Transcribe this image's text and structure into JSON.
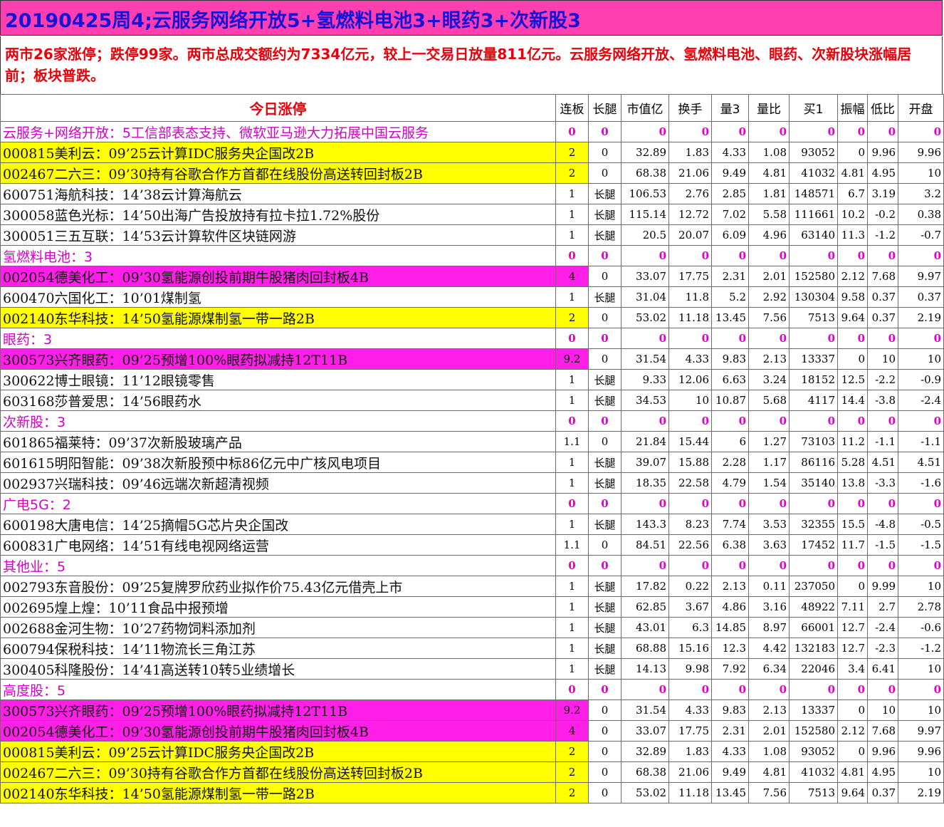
{
  "title": "20190425周4;云服务网络开放5+氢燃料电池3+眼药3+次新股3",
  "summary": "两市26家涨停；跌停99家。两市总成交额约为7334亿元，较上一交易日放量811亿元。云服务网络开放、氢燃料电池、眼药、次新股块涨幅居前；板块普跌。",
  "headers": [
    "今日涨停",
    "连板",
    "长腿",
    "市值亿",
    "换手",
    "量3",
    "量比",
    "买1",
    "振幅",
    "低比",
    "开盘"
  ],
  "rows": [
    {
      "type": "cat",
      "name": "云服务+网络开放：5工信部表态支持、微软亚马逊大力拓展中国云服务",
      "vals": [
        "0",
        "0",
        "0",
        "0",
        "0",
        "0",
        "0",
        "0",
        "0",
        "0"
      ]
    },
    {
      "type": "stock",
      "hl": "yellow",
      "name": "000815美利云：09’25云计算IDC服务央企国改2B",
      "vals": [
        "2",
        "0",
        "32.89",
        "1.83",
        "4.33",
        "1.08",
        "93052",
        "0",
        "9.96",
        "9.96"
      ]
    },
    {
      "type": "stock",
      "hl": "yellow",
      "name": "002467二六三：09’30持有谷歌合作方首都在线股份高送转回封板2B",
      "vals": [
        "2",
        "0",
        "68.38",
        "21.06",
        "9.49",
        "4.81",
        "41032",
        "4.81",
        "4.95",
        "10"
      ]
    },
    {
      "type": "stock",
      "hl": "",
      "name": "600751海航科技：14’38云计算海航云",
      "vals": [
        "1",
        "长腿",
        "106.53",
        "2.76",
        "2.85",
        "1.81",
        "148571",
        "6.7",
        "3.19",
        "3.2"
      ]
    },
    {
      "type": "stock",
      "hl": "",
      "name": "300058蓝色光标：14’50出海广告投放持有拉卡拉1.72%股份",
      "vals": [
        "1",
        "长腿",
        "115.14",
        "12.72",
        "7.02",
        "5.58",
        "111661",
        "10.2",
        "-0.2",
        "0.38"
      ]
    },
    {
      "type": "stock",
      "hl": "",
      "name": "300051三五互联：14’53云计算软件区块链网游",
      "vals": [
        "1",
        "长腿",
        "20.5",
        "20.07",
        "6.09",
        "4.96",
        "63140",
        "11.3",
        "-1.2",
        "-0.7"
      ]
    },
    {
      "type": "cat",
      "name": "氢燃料电池：3",
      "vals": [
        "0",
        "0",
        "0",
        "0",
        "0",
        "0",
        "0",
        "0",
        "0",
        "0"
      ]
    },
    {
      "type": "stock",
      "hl": "magenta",
      "name": "002054德美化工：09’30氢能源创投前期牛股猪肉回封板4B",
      "vals": [
        "4",
        "0",
        "33.07",
        "17.75",
        "2.31",
        "2.01",
        "152580",
        "2.12",
        "7.68",
        "9.97"
      ]
    },
    {
      "type": "stock",
      "hl": "",
      "name": "600470六国化工：10’01煤制氢",
      "vals": [
        "1",
        "长腿",
        "31.04",
        "11.8",
        "5.2",
        "2.92",
        "130304",
        "9.58",
        "0.37",
        "0.37"
      ]
    },
    {
      "type": "stock",
      "hl": "yellow",
      "name": "002140东华科技：14’50氢能源煤制氢一带一路2B",
      "vals": [
        "2",
        "0",
        "53.02",
        "11.18",
        "13.45",
        "7.56",
        "7513",
        "9.64",
        "0.37",
        "2.19"
      ]
    },
    {
      "type": "cat",
      "name": "眼药：3",
      "vals": [
        "0",
        "0",
        "0",
        "0",
        "0",
        "0",
        "0",
        "0",
        "0",
        "0"
      ]
    },
    {
      "type": "stock",
      "hl": "magenta",
      "name": "300573兴齐眼药：09’25预增100%眼药拟减持12T11B",
      "vals": [
        "9.2",
        "0",
        "31.54",
        "4.33",
        "9.83",
        "2.13",
        "13337",
        "0",
        "10",
        "10"
      ]
    },
    {
      "type": "stock",
      "hl": "",
      "name": "300622博士眼镜：11’12眼镜零售",
      "vals": [
        "1",
        "长腿",
        "9.33",
        "12.06",
        "6.63",
        "3.24",
        "18152",
        "12.5",
        "-2.2",
        "-0.9"
      ]
    },
    {
      "type": "stock",
      "hl": "",
      "name": "603168莎普爱思：14’56眼药水",
      "vals": [
        "1",
        "长腿",
        "34.53",
        "10",
        "10.87",
        "5.68",
        "4117",
        "14.4",
        "-3.8",
        "-2.4"
      ]
    },
    {
      "type": "cat",
      "name": "次新股：3",
      "vals": [
        "0",
        "0",
        "0",
        "0",
        "0",
        "0",
        "0",
        "0",
        "0",
        "0"
      ]
    },
    {
      "type": "stock",
      "hl": "",
      "name": "601865福莱特：09’37次新股玻璃产品",
      "vals": [
        "1.1",
        "0",
        "21.84",
        "15.44",
        "6",
        "1.27",
        "73103",
        "11.2",
        "-1.1",
        "-1.1"
      ]
    },
    {
      "type": "stock",
      "hl": "",
      "name": "601615明阳智能：09’38次新股预中标86亿元中广核风电项目",
      "vals": [
        "1",
        "长腿",
        "39.07",
        "15.88",
        "2.28",
        "1.17",
        "86116",
        "5.28",
        "4.51",
        "4.51"
      ]
    },
    {
      "type": "stock",
      "hl": "",
      "name": "002937兴瑞科技：09’46远端次新超清视频",
      "vals": [
        "1",
        "长腿",
        "18.35",
        "22.58",
        "4.79",
        "1.54",
        "35140",
        "13.8",
        "-3.3",
        "-1.6"
      ]
    },
    {
      "type": "cat",
      "name": "广电5G：2",
      "vals": [
        "0",
        "0",
        "0",
        "0",
        "0",
        "0",
        "0",
        "0",
        "0",
        "0"
      ]
    },
    {
      "type": "stock",
      "hl": "",
      "name": "600198大唐电信：14’25摘帽5G芯片央企国改",
      "vals": [
        "1",
        "长腿",
        "143.3",
        "8.23",
        "7.74",
        "3.53",
        "32355",
        "15.5",
        "-4.8",
        "-0.5"
      ]
    },
    {
      "type": "stock",
      "hl": "",
      "name": "600831广电网络：14’51有线电视网络运营",
      "vals": [
        "1.1",
        "0",
        "84.51",
        "22.56",
        "6.38",
        "3.63",
        "17452",
        "11.7",
        "-1.5",
        "-1.5"
      ]
    },
    {
      "type": "cat",
      "name": "其他业：5",
      "vals": [
        "0",
        "0",
        "0",
        "0",
        "0",
        "0",
        "0",
        "0",
        "0",
        "0"
      ]
    },
    {
      "type": "stock",
      "hl": "",
      "name": "002793东音股份：09’25复牌罗欣药业拟作价75.43亿元借壳上市",
      "vals": [
        "1",
        "长腿",
        "17.82",
        "0.22",
        "2.13",
        "0.11",
        "237050",
        "0",
        "9.99",
        "10"
      ]
    },
    {
      "type": "stock",
      "hl": "",
      "name": "002695煌上煌：10’11食品中报预增",
      "vals": [
        "1",
        "长腿",
        "62.85",
        "3.67",
        "4.86",
        "3.16",
        "48922",
        "7.11",
        "2.7",
        "2.78"
      ]
    },
    {
      "type": "stock",
      "hl": "",
      "name": "002688金河生物：10’27药物饲料添加剂",
      "vals": [
        "1",
        "长腿",
        "43.01",
        "6.3",
        "14.85",
        "8.97",
        "66001",
        "12.7",
        "-2.4",
        "-0.6"
      ]
    },
    {
      "type": "stock",
      "hl": "",
      "name": "600794保税科技：14’11物流长三角江苏",
      "vals": [
        "1",
        "长腿",
        "68.88",
        "15.16",
        "12.3",
        "4.42",
        "132183",
        "12.7",
        "-2.3",
        "-1.2"
      ]
    },
    {
      "type": "stock",
      "hl": "",
      "name": "300405科隆股份：14’41高送转10转5业绩增长",
      "vals": [
        "1",
        "长腿",
        "14.13",
        "9.98",
        "7.92",
        "6.34",
        "22046",
        "3.4",
        "6.41",
        "10"
      ]
    },
    {
      "type": "cat",
      "name": "高度股：5",
      "vals": [
        "0",
        "0",
        "0",
        "0",
        "0",
        "0",
        "0",
        "0",
        "0",
        "0"
      ]
    },
    {
      "type": "stock",
      "hl": "magenta",
      "name": "300573兴齐眼药：09’25预增100%眼药拟减持12T11B",
      "vals": [
        "9.2",
        "0",
        "31.54",
        "4.33",
        "9.83",
        "2.13",
        "13337",
        "0",
        "10",
        "10"
      ]
    },
    {
      "type": "stock",
      "hl": "magenta",
      "name": "002054德美化工：09’30氢能源创投前期牛股猪肉回封板4B",
      "vals": [
        "4",
        "0",
        "33.07",
        "17.75",
        "2.31",
        "2.01",
        "152580",
        "2.12",
        "7.68",
        "9.97"
      ]
    },
    {
      "type": "stock",
      "hl": "yellow",
      "name": "000815美利云：09’25云计算IDC服务央企国改2B",
      "vals": [
        "2",
        "0",
        "32.89",
        "1.83",
        "4.33",
        "1.08",
        "93052",
        "0",
        "9.96",
        "9.96"
      ]
    },
    {
      "type": "stock",
      "hl": "yellow",
      "name": "002467二六三：09’30持有谷歌合作方首都在线股份高送转回封板2B",
      "vals": [
        "2",
        "0",
        "68.38",
        "21.06",
        "9.49",
        "4.81",
        "41032",
        "4.81",
        "4.95",
        "10"
      ]
    },
    {
      "type": "stock",
      "hl": "yellow",
      "name": "002140东华科技：14’50氢能源煤制氢一带一路2B",
      "vals": [
        "2",
        "0",
        "53.02",
        "11.18",
        "13.45",
        "7.56",
        "7513",
        "9.64",
        "0.37",
        "2.19"
      ]
    }
  ]
}
